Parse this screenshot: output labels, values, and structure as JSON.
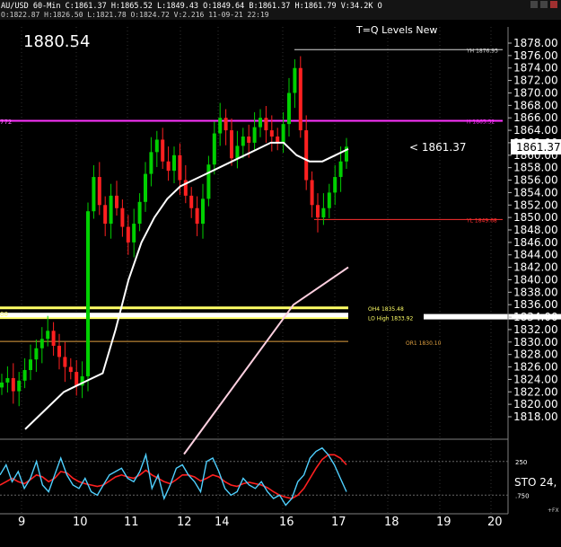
{
  "header": {
    "symbol_line": "AU/USD 60-Min  C:1861.37  H:1865.52  L:1849.43  O:1849.64  B:1861.37  H:1861.79  V:34.2K  O",
    "info_line": "O:1822.87  H:1826.50  L:1821.78  O:1824.72  V:2.216  11-09-21  22:19"
  },
  "price_box": {
    "value": "1880.54"
  },
  "chart_data": {
    "type": "candlestick",
    "title": "T=Q Levels New",
    "timeframe": "60-Min",
    "ylim": [
      1816,
      1880
    ],
    "y_ticks": [
      1818,
      1820,
      1822,
      1824,
      1826,
      1828,
      1830,
      1832,
      1834,
      1836,
      1838,
      1840,
      1842,
      1844,
      1846,
      1848,
      1850,
      1852,
      1854,
      1856,
      1858,
      1860,
      1862,
      1864,
      1866,
      1868,
      1870,
      1872,
      1874,
      1876,
      1878
    ],
    "x_ticks": [
      "9",
      "10",
      "11",
      "12",
      "14",
      "16",
      "17",
      "18",
      "19",
      "20"
    ],
    "last_price": "1861.37",
    "last_price_label": "< 1861.37",
    "close_sample": [
      1823.5,
      1824.2,
      1822.1,
      1823.8,
      1825.5,
      1827.2,
      1829.0,
      1830.5,
      1831.8,
      1829.4,
      1827.6,
      1826.0,
      1825.2,
      1823.0,
      1824.5,
      1851.0,
      1856.5,
      1852.0,
      1849.0,
      1853.5,
      1851.5,
      1848.5,
      1846.0,
      1849.0,
      1852.5,
      1857.0,
      1860.5,
      1862.5,
      1859.0,
      1857.5,
      1860.0,
      1856.0,
      1853.5,
      1851.5,
      1849.0,
      1853.0,
      1858.5,
      1863.5,
      1866.0,
      1864.0,
      1859.5,
      1861.5,
      1863.0,
      1862.0,
      1864.5,
      1866.0,
      1864.0,
      1863.0,
      1862.0,
      1865.0,
      1870.0,
      1874.0,
      1864.0,
      1856.0,
      1852.0,
      1850.0,
      1851.5,
      1854.0,
      1856.5,
      1859.0,
      1861.37
    ],
    "ma_fast": [
      1816,
      1818,
      1820,
      1822,
      1823,
      1824,
      1825,
      1832,
      1840,
      1846,
      1850,
      1853,
      1855,
      1856,
      1857,
      1858,
      1859,
      1860,
      1861,
      1862,
      1862,
      1860,
      1859,
      1859,
      1860,
      1861
    ],
    "ma_slow": [
      1812,
      1818,
      1824,
      1830,
      1836,
      1839,
      1842
    ],
    "levels": [
      {
        "label": "YH 1876.95",
        "price": 1876.95,
        "color": "#d8d8d8"
      },
      {
        "label": "H 1865.52",
        "price": 1865.52,
        "color": "#ff33ff"
      },
      {
        "label": "YL 1849.68",
        "price": 1849.68,
        "color": "#ff3030"
      },
      {
        "label": "OH4 1835.48",
        "price": 1835.48,
        "color": "#ffff66"
      },
      {
        "label": "LO High 1833.92",
        "price": 1833.92,
        "color": "#ffff66"
      },
      {
        "label": "OR1 1830.10",
        "price": 1830.1,
        "color": "#e0a040"
      }
    ],
    "left_level_label": "772",
    "left_level_label_2": "00",
    "indicator": {
      "name": "STO 24,",
      "ticks": [
        "250",
        ".750"
      ],
      "fx_label": "+FX",
      "fast": [
        0.55,
        0.7,
        0.45,
        0.6,
        0.35,
        0.5,
        0.75,
        0.4,
        0.3,
        0.55,
        0.8,
        0.55,
        0.4,
        0.35,
        0.5,
        0.3,
        0.25,
        0.4,
        0.55,
        0.6,
        0.65,
        0.5,
        0.45,
        0.6,
        0.85,
        0.35,
        0.55,
        0.2,
        0.4,
        0.65,
        0.7,
        0.55,
        0.45,
        0.3,
        0.75,
        0.8,
        0.6,
        0.35,
        0.25,
        0.3,
        0.5,
        0.4,
        0.35,
        0.45,
        0.3,
        0.2,
        0.25,
        0.1,
        0.2,
        0.45,
        0.55,
        0.8,
        0.9,
        0.95,
        0.85,
        0.7,
        0.5,
        0.3
      ],
      "slow": [
        0.4,
        0.45,
        0.5,
        0.45,
        0.42,
        0.48,
        0.55,
        0.52,
        0.45,
        0.5,
        0.6,
        0.58,
        0.5,
        0.45,
        0.42,
        0.4,
        0.38,
        0.4,
        0.46,
        0.52,
        0.55,
        0.52,
        0.5,
        0.55,
        0.62,
        0.55,
        0.5,
        0.45,
        0.42,
        0.48,
        0.55,
        0.55,
        0.52,
        0.46,
        0.5,
        0.55,
        0.52,
        0.45,
        0.4,
        0.38,
        0.42,
        0.44,
        0.42,
        0.4,
        0.36,
        0.3,
        0.25,
        0.22,
        0.2,
        0.25,
        0.35,
        0.5,
        0.65,
        0.78,
        0.85,
        0.85,
        0.8,
        0.7
      ]
    }
  },
  "colors": {
    "bull": "#00d000",
    "bear": "#ff2020",
    "ma_fast": "#ffffff",
    "ma_slow": "#ffd0e0",
    "sto_fast": "#4fd0ff",
    "sto_slow": "#ff2020",
    "grid": "#303030"
  }
}
